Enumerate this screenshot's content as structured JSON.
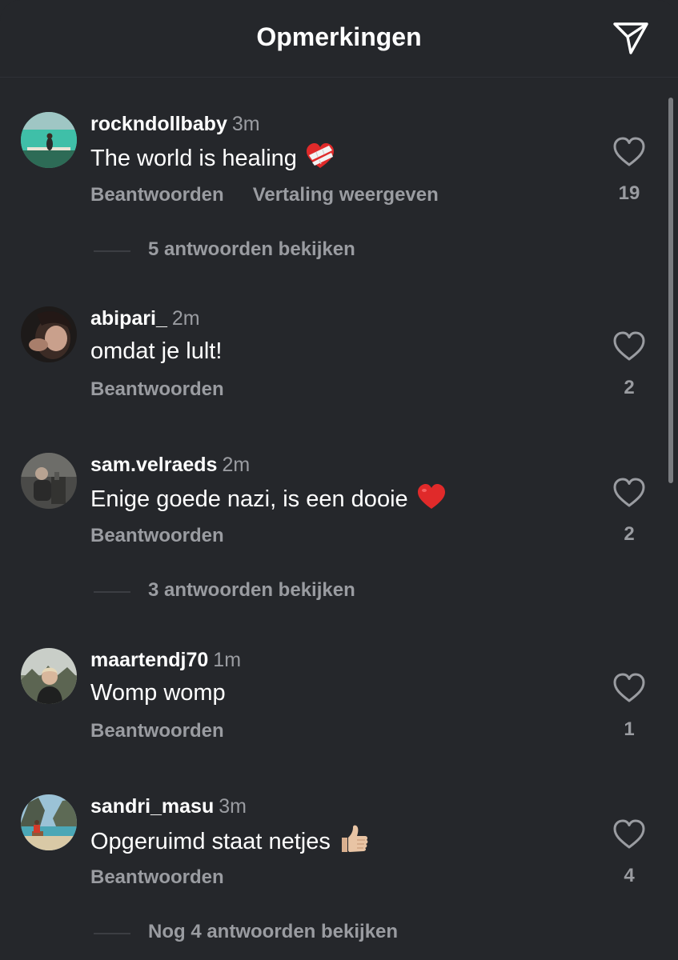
{
  "header": {
    "title": "Opmerkingen",
    "share_icon": "paper-plane-icon"
  },
  "comments": [
    {
      "username": "rockndollbaby",
      "time": "3m",
      "text": "The world is healing",
      "emoji": "mending-heart",
      "reply_label": "Beantwoorden",
      "translate_label": "Vertaling weergeven",
      "likes": "19",
      "replies_label": "5 antwoorden bekijken"
    },
    {
      "username": "abipari_",
      "time": "2m",
      "text": "omdat je lult!",
      "reply_label": "Beantwoorden",
      "likes": "2"
    },
    {
      "username": "sam.velraeds",
      "time": "2m",
      "text": "Enige goede nazi, is een dooie",
      "emoji": "red-heart",
      "reply_label": "Beantwoorden",
      "likes": "2",
      "replies_label": "3 antwoorden bekijken"
    },
    {
      "username": "maartendj70",
      "time": "1m",
      "text": "Womp womp",
      "reply_label": "Beantwoorden",
      "likes": "1"
    },
    {
      "username": "sandri_masu",
      "time": "3m",
      "text": "Opgeruimd staat netjes",
      "emoji": "thumbs-up",
      "reply_label": "Beantwoorden",
      "likes": "4",
      "replies_label": "Nog 4 antwoorden bekijken"
    }
  ],
  "colors": {
    "background": "#25272b",
    "text": "#ffffff",
    "muted": "#9a9ca1",
    "heart_emoji": "#e02a2a"
  }
}
